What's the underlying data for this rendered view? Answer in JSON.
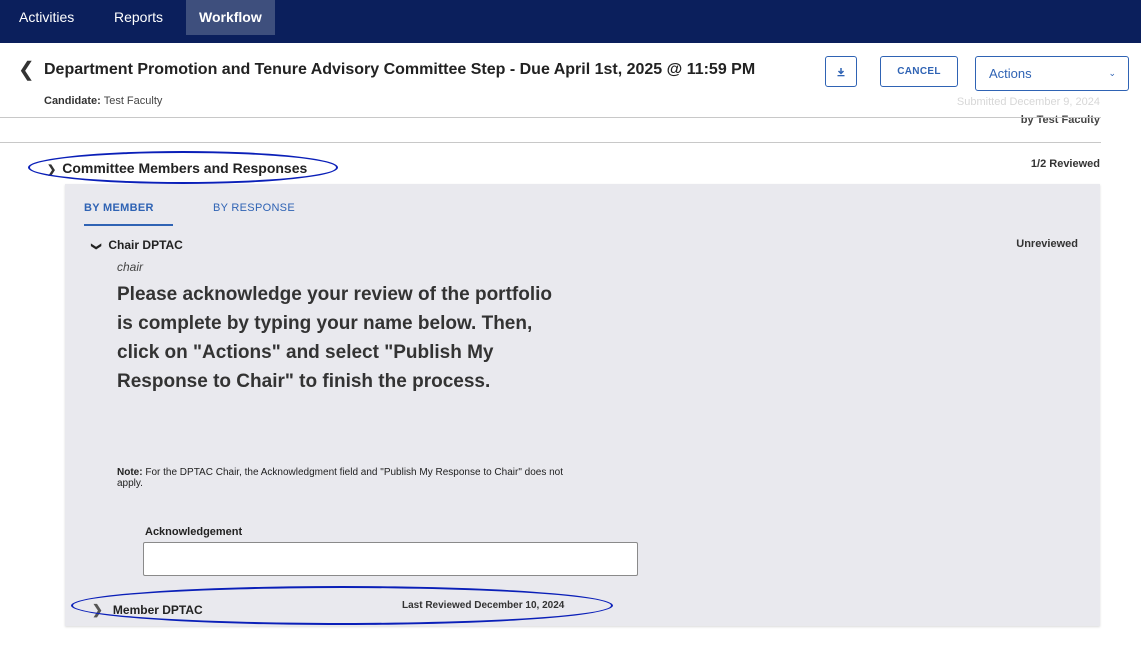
{
  "nav": {
    "tabs": [
      {
        "label": "Activities"
      },
      {
        "label": "Reports"
      },
      {
        "label": "Workflow",
        "active": true
      }
    ]
  },
  "header": {
    "title": "Department Promotion and Tenure Advisory Committee Step - Due April 1st, 2025 @ 11:59 PM",
    "candidate_label": "Candidate:",
    "candidate_value": "Test Faculty",
    "submitted": "Submitted December 9, 2024",
    "submitted_by": "by Test Faculty",
    "cancel_label": "CANCEL",
    "actions_label": "Actions",
    "download_icon": "download-icon",
    "back_icon": "chevron-left-icon"
  },
  "section": {
    "title": "Committee Members and Responses",
    "reviewed_count": "1/2 Reviewed",
    "tabs": [
      {
        "label": "BY MEMBER",
        "active": true
      },
      {
        "label": "BY RESPONSE"
      }
    ]
  },
  "member_chair": {
    "name": "Chair DPTAC",
    "role": "chair",
    "status": "Unreviewed",
    "instructions": "Please acknowledge your review of the portfolio is complete by typing your name below. Then, click on \"Actions\" and select \"Publish My Response to Chair\" to finish the process.",
    "note_label": "Note:",
    "note_text": " For the DPTAC Chair, the Acknowledgment field and \"Publish My Response to Chair\" does not apply.",
    "ack_label": "Acknowledgement",
    "ack_value": ""
  },
  "member_dptac": {
    "name": "Member DPTAC",
    "last_reviewed": "Last Reviewed December 10, 2024"
  },
  "colors": {
    "nav_bg": "#0b1f5c",
    "accent": "#2f63b4",
    "panel_bg": "#e9e9ee",
    "annotation": "#0a1fb8"
  }
}
